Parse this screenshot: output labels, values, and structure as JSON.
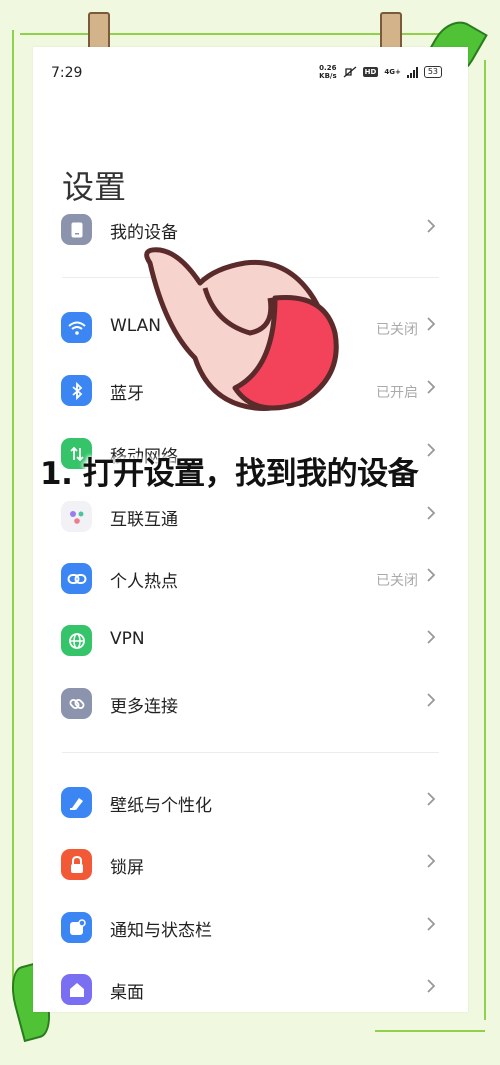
{
  "status_bar": {
    "time": "7:29",
    "net_speed_value": "0.26",
    "net_speed_unit": "KB/s",
    "hd": "HD",
    "network": "4G+",
    "battery": "53"
  },
  "page_title": "设置",
  "overlay_caption": "1. 打开设置，找到我的设备",
  "rows": [
    {
      "label": "我的设备",
      "value": "",
      "icon": "device-icon",
      "color": "#8c93ad"
    },
    {
      "label": "WLAN",
      "value": "已关闭",
      "icon": "wifi-icon",
      "color": "#3c86f4"
    },
    {
      "label": "蓝牙",
      "value": "已开启",
      "icon": "bluetooth-icon",
      "color": "#3c86f4"
    },
    {
      "label": "移动网络",
      "value": "",
      "icon": "mobile-network-icon",
      "color": "#35c46a"
    },
    {
      "label": "互联互通",
      "value": "",
      "icon": "interconnect-icon",
      "color": "#f2f2f6"
    },
    {
      "label": "个人热点",
      "value": "已关闭",
      "icon": "hotspot-icon",
      "color": "#3c86f4"
    },
    {
      "label": "VPN",
      "value": "",
      "icon": "vpn-icon",
      "color": "#35c46a"
    },
    {
      "label": "更多连接",
      "value": "",
      "icon": "more-connections-icon",
      "color": "#8c93ad"
    },
    {
      "label": "壁纸与个性化",
      "value": "",
      "icon": "wallpaper-icon",
      "color": "#3c86f4"
    },
    {
      "label": "锁屏",
      "value": "",
      "icon": "lock-icon",
      "color": "#f25a37"
    },
    {
      "label": "通知与状态栏",
      "value": "",
      "icon": "notification-icon",
      "color": "#3c86f4"
    },
    {
      "label": "桌面",
      "value": "",
      "icon": "home-screen-icon",
      "color": "#7a6ff2"
    }
  ]
}
